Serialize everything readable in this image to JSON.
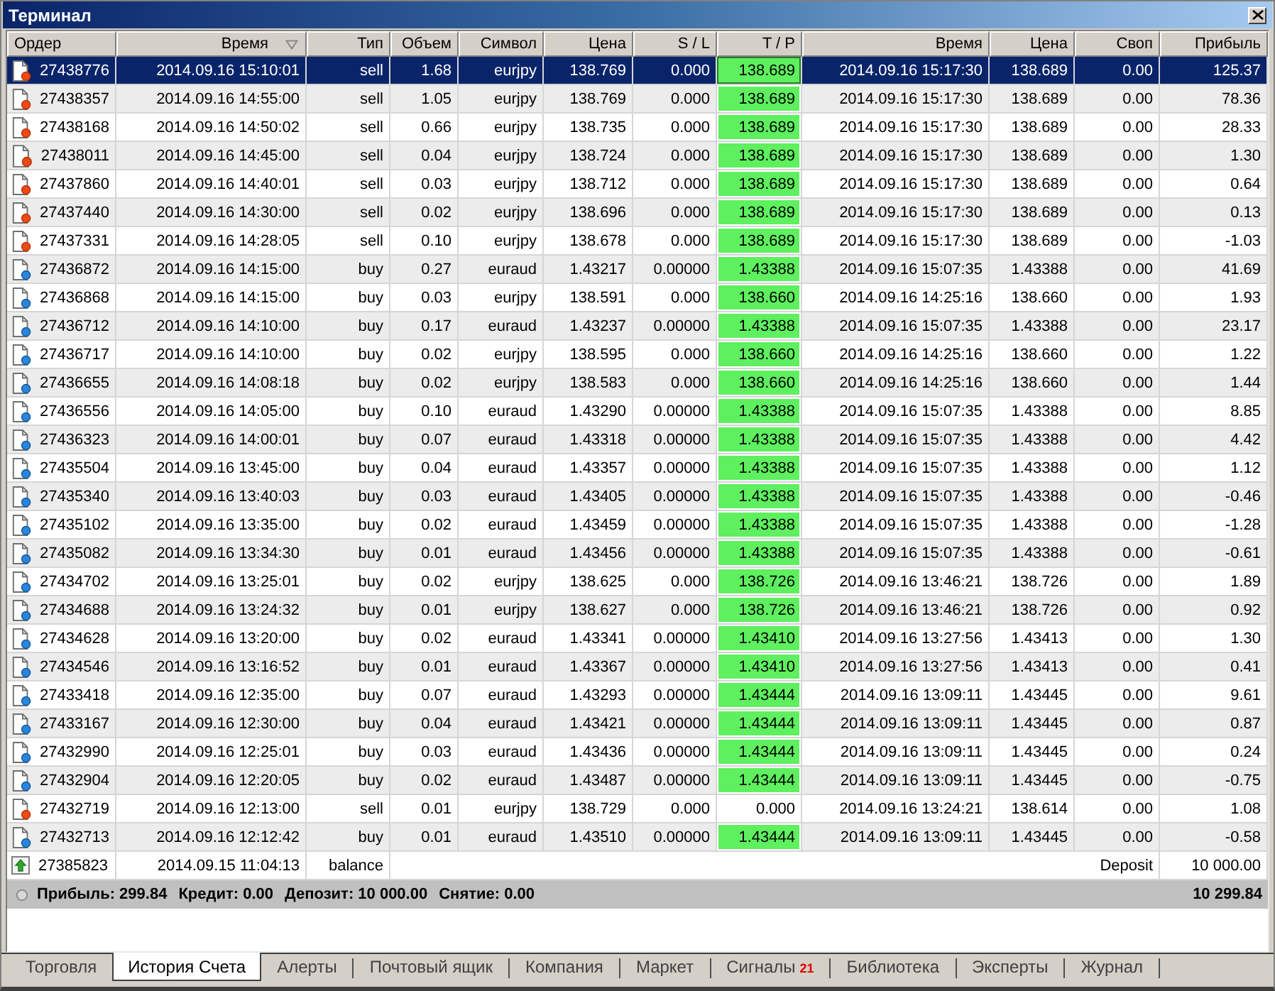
{
  "window": {
    "title": "Терминал"
  },
  "table": {
    "columns": [
      {
        "label": "Ордер",
        "sorted": false
      },
      {
        "label": "Время",
        "sorted": true
      },
      {
        "label": "Тип",
        "sorted": false
      },
      {
        "label": "Объем",
        "sorted": false
      },
      {
        "label": "Символ",
        "sorted": false
      },
      {
        "label": "Цена",
        "sorted": false
      },
      {
        "label": "S / L",
        "sorted": false
      },
      {
        "label": "T / P",
        "sorted": false
      },
      {
        "label": "Время",
        "sorted": false
      },
      {
        "label": "Цена",
        "sorted": false
      },
      {
        "label": "Своп",
        "sorted": false
      },
      {
        "label": "Прибыль",
        "sorted": false
      }
    ],
    "rows": [
      {
        "kind": "sell",
        "selected": true,
        "order": "27438776",
        "open_time": "2014.09.16 15:10:01",
        "type": "sell",
        "volume": "1.68",
        "symbol": "eurjpy",
        "open_price": "138.769",
        "sl": "0.000",
        "tp": "138.689",
        "tp_highlighted": true,
        "close_time": "2014.09.16 15:17:30",
        "close_price": "138.689",
        "swap": "0.00",
        "profit": "125.37"
      },
      {
        "kind": "sell",
        "selected": false,
        "order": "27438357",
        "open_time": "2014.09.16 14:55:00",
        "type": "sell",
        "volume": "1.05",
        "symbol": "eurjpy",
        "open_price": "138.769",
        "sl": "0.000",
        "tp": "138.689",
        "tp_highlighted": true,
        "close_time": "2014.09.16 15:17:30",
        "close_price": "138.689",
        "swap": "0.00",
        "profit": "78.36"
      },
      {
        "kind": "sell",
        "selected": false,
        "order": "27438168",
        "open_time": "2014.09.16 14:50:02",
        "type": "sell",
        "volume": "0.66",
        "symbol": "eurjpy",
        "open_price": "138.735",
        "sl": "0.000",
        "tp": "138.689",
        "tp_highlighted": true,
        "close_time": "2014.09.16 15:17:30",
        "close_price": "138.689",
        "swap": "0.00",
        "profit": "28.33"
      },
      {
        "kind": "sell",
        "selected": false,
        "order": "27438011",
        "open_time": "2014.09.16 14:45:00",
        "type": "sell",
        "volume": "0.04",
        "symbol": "eurjpy",
        "open_price": "138.724",
        "sl": "0.000",
        "tp": "138.689",
        "tp_highlighted": true,
        "close_time": "2014.09.16 15:17:30",
        "close_price": "138.689",
        "swap": "0.00",
        "profit": "1.30"
      },
      {
        "kind": "sell",
        "selected": false,
        "order": "27437860",
        "open_time": "2014.09.16 14:40:01",
        "type": "sell",
        "volume": "0.03",
        "symbol": "eurjpy",
        "open_price": "138.712",
        "sl": "0.000",
        "tp": "138.689",
        "tp_highlighted": true,
        "close_time": "2014.09.16 15:17:30",
        "close_price": "138.689",
        "swap": "0.00",
        "profit": "0.64"
      },
      {
        "kind": "sell",
        "selected": false,
        "order": "27437440",
        "open_time": "2014.09.16 14:30:00",
        "type": "sell",
        "volume": "0.02",
        "symbol": "eurjpy",
        "open_price": "138.696",
        "sl": "0.000",
        "tp": "138.689",
        "tp_highlighted": true,
        "close_time": "2014.09.16 15:17:30",
        "close_price": "138.689",
        "swap": "0.00",
        "profit": "0.13"
      },
      {
        "kind": "sell",
        "selected": false,
        "order": "27437331",
        "open_time": "2014.09.16 14:28:05",
        "type": "sell",
        "volume": "0.10",
        "symbol": "eurjpy",
        "open_price": "138.678",
        "sl": "0.000",
        "tp": "138.689",
        "tp_highlighted": true,
        "close_time": "2014.09.16 15:17:30",
        "close_price": "138.689",
        "swap": "0.00",
        "profit": "-1.03"
      },
      {
        "kind": "buy",
        "selected": false,
        "order": "27436872",
        "open_time": "2014.09.16 14:15:00",
        "type": "buy",
        "volume": "0.27",
        "symbol": "euraud",
        "open_price": "1.43217",
        "sl": "0.00000",
        "tp": "1.43388",
        "tp_highlighted": true,
        "close_time": "2014.09.16 15:07:35",
        "close_price": "1.43388",
        "swap": "0.00",
        "profit": "41.69"
      },
      {
        "kind": "buy",
        "selected": false,
        "order": "27436868",
        "open_time": "2014.09.16 14:15:00",
        "type": "buy",
        "volume": "0.03",
        "symbol": "eurjpy",
        "open_price": "138.591",
        "sl": "0.000",
        "tp": "138.660",
        "tp_highlighted": true,
        "close_time": "2014.09.16 14:25:16",
        "close_price": "138.660",
        "swap": "0.00",
        "profit": "1.93"
      },
      {
        "kind": "buy",
        "selected": false,
        "order": "27436712",
        "open_time": "2014.09.16 14:10:00",
        "type": "buy",
        "volume": "0.17",
        "symbol": "euraud",
        "open_price": "1.43237",
        "sl": "0.00000",
        "tp": "1.43388",
        "tp_highlighted": true,
        "close_time": "2014.09.16 15:07:35",
        "close_price": "1.43388",
        "swap": "0.00",
        "profit": "23.17"
      },
      {
        "kind": "buy",
        "selected": false,
        "order": "27436717",
        "open_time": "2014.09.16 14:10:00",
        "type": "buy",
        "volume": "0.02",
        "symbol": "eurjpy",
        "open_price": "138.595",
        "sl": "0.000",
        "tp": "138.660",
        "tp_highlighted": true,
        "close_time": "2014.09.16 14:25:16",
        "close_price": "138.660",
        "swap": "0.00",
        "profit": "1.22"
      },
      {
        "kind": "buy",
        "selected": false,
        "order": "27436655",
        "open_time": "2014.09.16 14:08:18",
        "type": "buy",
        "volume": "0.02",
        "symbol": "eurjpy",
        "open_price": "138.583",
        "sl": "0.000",
        "tp": "138.660",
        "tp_highlighted": true,
        "close_time": "2014.09.16 14:25:16",
        "close_price": "138.660",
        "swap": "0.00",
        "profit": "1.44"
      },
      {
        "kind": "buy",
        "selected": false,
        "order": "27436556",
        "open_time": "2014.09.16 14:05:00",
        "type": "buy",
        "volume": "0.10",
        "symbol": "euraud",
        "open_price": "1.43290",
        "sl": "0.00000",
        "tp": "1.43388",
        "tp_highlighted": true,
        "close_time": "2014.09.16 15:07:35",
        "close_price": "1.43388",
        "swap": "0.00",
        "profit": "8.85"
      },
      {
        "kind": "buy",
        "selected": false,
        "order": "27436323",
        "open_time": "2014.09.16 14:00:01",
        "type": "buy",
        "volume": "0.07",
        "symbol": "euraud",
        "open_price": "1.43318",
        "sl": "0.00000",
        "tp": "1.43388",
        "tp_highlighted": true,
        "close_time": "2014.09.16 15:07:35",
        "close_price": "1.43388",
        "swap": "0.00",
        "profit": "4.42"
      },
      {
        "kind": "buy",
        "selected": false,
        "order": "27435504",
        "open_time": "2014.09.16 13:45:00",
        "type": "buy",
        "volume": "0.04",
        "symbol": "euraud",
        "open_price": "1.43357",
        "sl": "0.00000",
        "tp": "1.43388",
        "tp_highlighted": true,
        "close_time": "2014.09.16 15:07:35",
        "close_price": "1.43388",
        "swap": "0.00",
        "profit": "1.12"
      },
      {
        "kind": "buy",
        "selected": false,
        "order": "27435340",
        "open_time": "2014.09.16 13:40:03",
        "type": "buy",
        "volume": "0.03",
        "symbol": "euraud",
        "open_price": "1.43405",
        "sl": "0.00000",
        "tp": "1.43388",
        "tp_highlighted": true,
        "close_time": "2014.09.16 15:07:35",
        "close_price": "1.43388",
        "swap": "0.00",
        "profit": "-0.46"
      },
      {
        "kind": "buy",
        "selected": false,
        "order": "27435102",
        "open_time": "2014.09.16 13:35:00",
        "type": "buy",
        "volume": "0.02",
        "symbol": "euraud",
        "open_price": "1.43459",
        "sl": "0.00000",
        "tp": "1.43388",
        "tp_highlighted": true,
        "close_time": "2014.09.16 15:07:35",
        "close_price": "1.43388",
        "swap": "0.00",
        "profit": "-1.28"
      },
      {
        "kind": "buy",
        "selected": false,
        "order": "27435082",
        "open_time": "2014.09.16 13:34:30",
        "type": "buy",
        "volume": "0.01",
        "symbol": "euraud",
        "open_price": "1.43456",
        "sl": "0.00000",
        "tp": "1.43388",
        "tp_highlighted": true,
        "close_time": "2014.09.16 15:07:35",
        "close_price": "1.43388",
        "swap": "0.00",
        "profit": "-0.61"
      },
      {
        "kind": "buy",
        "selected": false,
        "order": "27434702",
        "open_time": "2014.09.16 13:25:01",
        "type": "buy",
        "volume": "0.02",
        "symbol": "eurjpy",
        "open_price": "138.625",
        "sl": "0.000",
        "tp": "138.726",
        "tp_highlighted": true,
        "close_time": "2014.09.16 13:46:21",
        "close_price": "138.726",
        "swap": "0.00",
        "profit": "1.89"
      },
      {
        "kind": "buy",
        "selected": false,
        "order": "27434688",
        "open_time": "2014.09.16 13:24:32",
        "type": "buy",
        "volume": "0.01",
        "symbol": "eurjpy",
        "open_price": "138.627",
        "sl": "0.000",
        "tp": "138.726",
        "tp_highlighted": true,
        "close_time": "2014.09.16 13:46:21",
        "close_price": "138.726",
        "swap": "0.00",
        "profit": "0.92"
      },
      {
        "kind": "buy",
        "selected": false,
        "order": "27434628",
        "open_time": "2014.09.16 13:20:00",
        "type": "buy",
        "volume": "0.02",
        "symbol": "euraud",
        "open_price": "1.43341",
        "sl": "0.00000",
        "tp": "1.43410",
        "tp_highlighted": true,
        "close_time": "2014.09.16 13:27:56",
        "close_price": "1.43413",
        "swap": "0.00",
        "profit": "1.30"
      },
      {
        "kind": "buy",
        "selected": false,
        "order": "27434546",
        "open_time": "2014.09.16 13:16:52",
        "type": "buy",
        "volume": "0.01",
        "symbol": "euraud",
        "open_price": "1.43367",
        "sl": "0.00000",
        "tp": "1.43410",
        "tp_highlighted": true,
        "close_time": "2014.09.16 13:27:56",
        "close_price": "1.43413",
        "swap": "0.00",
        "profit": "0.41"
      },
      {
        "kind": "buy",
        "selected": false,
        "order": "27433418",
        "open_time": "2014.09.16 12:35:00",
        "type": "buy",
        "volume": "0.07",
        "symbol": "euraud",
        "open_price": "1.43293",
        "sl": "0.00000",
        "tp": "1.43444",
        "tp_highlighted": true,
        "close_time": "2014.09.16 13:09:11",
        "close_price": "1.43445",
        "swap": "0.00",
        "profit": "9.61"
      },
      {
        "kind": "buy",
        "selected": false,
        "order": "27433167",
        "open_time": "2014.09.16 12:30:00",
        "type": "buy",
        "volume": "0.04",
        "symbol": "euraud",
        "open_price": "1.43421",
        "sl": "0.00000",
        "tp": "1.43444",
        "tp_highlighted": true,
        "close_time": "2014.09.16 13:09:11",
        "close_price": "1.43445",
        "swap": "0.00",
        "profit": "0.87"
      },
      {
        "kind": "buy",
        "selected": false,
        "order": "27432990",
        "open_time": "2014.09.16 12:25:01",
        "type": "buy",
        "volume": "0.03",
        "symbol": "euraud",
        "open_price": "1.43436",
        "sl": "0.00000",
        "tp": "1.43444",
        "tp_highlighted": true,
        "close_time": "2014.09.16 13:09:11",
        "close_price": "1.43445",
        "swap": "0.00",
        "profit": "0.24"
      },
      {
        "kind": "buy",
        "selected": false,
        "order": "27432904",
        "open_time": "2014.09.16 12:20:05",
        "type": "buy",
        "volume": "0.02",
        "symbol": "euraud",
        "open_price": "1.43487",
        "sl": "0.00000",
        "tp": "1.43444",
        "tp_highlighted": true,
        "close_time": "2014.09.16 13:09:11",
        "close_price": "1.43445",
        "swap": "0.00",
        "profit": "-0.75"
      },
      {
        "kind": "sell",
        "selected": false,
        "order": "27432719",
        "open_time": "2014.09.16 12:13:00",
        "type": "sell",
        "volume": "0.01",
        "symbol": "eurjpy",
        "open_price": "138.729",
        "sl": "0.000",
        "tp": "0.000",
        "tp_highlighted": false,
        "close_time": "2014.09.16 13:24:21",
        "close_price": "138.614",
        "swap": "0.00",
        "profit": "1.08"
      },
      {
        "kind": "buy",
        "selected": false,
        "order": "27432713",
        "open_time": "2014.09.16 12:12:42",
        "type": "buy",
        "volume": "0.01",
        "symbol": "euraud",
        "open_price": "1.43510",
        "sl": "0.00000",
        "tp": "1.43444",
        "tp_highlighted": true,
        "close_time": "2014.09.16 13:09:11",
        "close_price": "1.43445",
        "swap": "0.00",
        "profit": "-0.58"
      },
      {
        "kind": "balance",
        "selected": false,
        "order": "27385823",
        "open_time": "2014.09.15 11:04:13",
        "type": "balance",
        "comment": "Deposit",
        "profit": "10 000.00"
      }
    ]
  },
  "summary": {
    "items": [
      "Прибыль: 299.84",
      "Кредит: 0.00",
      "Депозит: 10 000.00",
      "Снятие: 0.00"
    ],
    "total": "10 299.84"
  },
  "tabs": [
    {
      "label": "Торговля",
      "selected": false
    },
    {
      "label": "История Счета",
      "selected": true
    },
    {
      "label": "Алерты",
      "selected": false
    },
    {
      "label": "Почтовый ящик",
      "selected": false
    },
    {
      "label": "Компания",
      "selected": false
    },
    {
      "label": "Маркет",
      "selected": false
    },
    {
      "label": "Сигналы",
      "badge": "21",
      "selected": false
    },
    {
      "label": "Библиотека",
      "selected": false
    },
    {
      "label": "Эксперты",
      "selected": false
    },
    {
      "label": "Журнал",
      "selected": false
    }
  ]
}
